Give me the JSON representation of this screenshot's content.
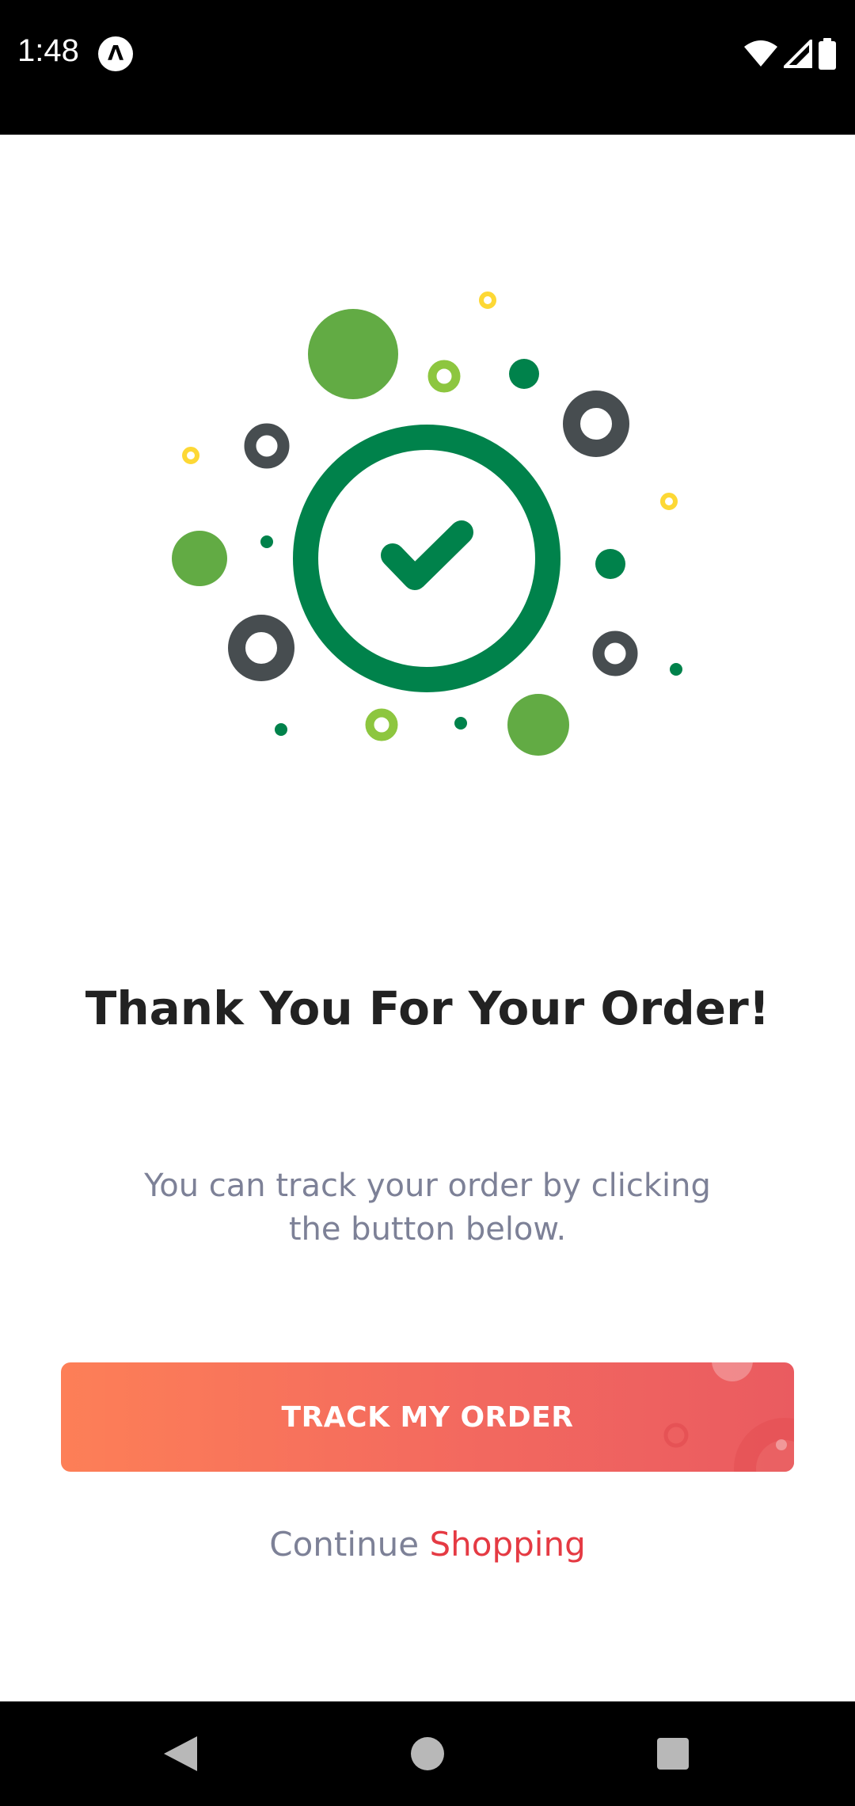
{
  "status_bar": {
    "time": "1:48",
    "notification_icon": "a-logo-icon",
    "icons": [
      "wifi-icon",
      "cellular-signal-icon",
      "battery-icon"
    ]
  },
  "confirmation": {
    "icon": "checkmark-circle-icon",
    "title": "Thank You For Your Order!",
    "subtitle": "You can track your order by clicking the button below."
  },
  "actions": {
    "track_button_label": "TRACK MY ORDER",
    "continue_prefix": "Continue",
    "continue_link": "Shopping"
  },
  "nav_bar": {
    "buttons": [
      "back-icon",
      "home-icon",
      "recents-icon"
    ]
  },
  "colors": {
    "brand_green": "#00824b",
    "light_green": "#62ab44",
    "lime": "#8dc63f",
    "dark_gray": "#474d50",
    "yellow": "#fdd835",
    "button_gradient_start": "#fd7f57",
    "button_gradient_end": "#ea5b60",
    "link_red": "#e53a43",
    "muted_text": "#7d8197",
    "title_text": "#222222"
  }
}
